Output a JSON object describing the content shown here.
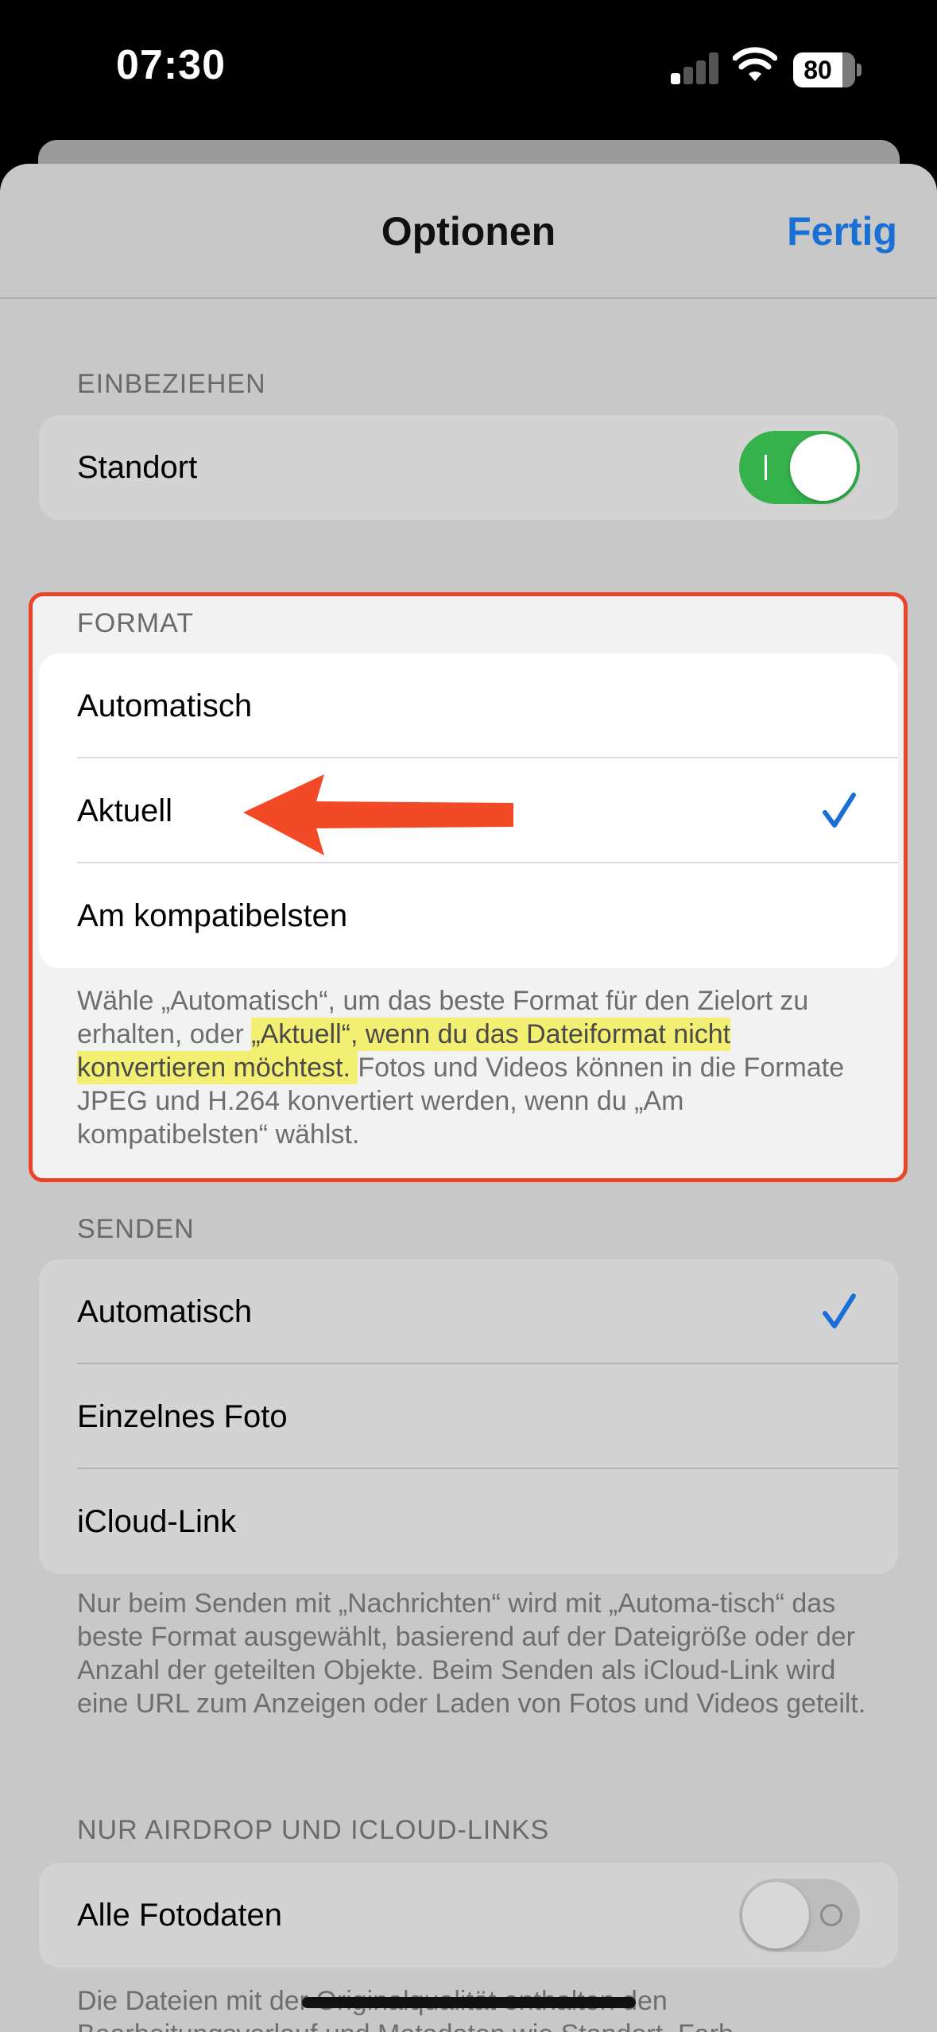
{
  "status_bar": {
    "time": "07:30",
    "battery_level": "80",
    "signal_bars_active": 1,
    "signal_bars_total": 4
  },
  "nav": {
    "title": "Optionen",
    "done_label": "Fertig"
  },
  "include": {
    "header": "EINBEZIEHEN",
    "location_label": "Standort",
    "location_on": true
  },
  "format": {
    "header": "FORMAT",
    "options": [
      "Automatisch",
      "Aktuell",
      "Am kompatibelsten"
    ],
    "selected": "Aktuell",
    "footnote_part1": "Wähle „Automatisch“, um das beste Format für den Zielort zu erhalten, oder ",
    "footnote_highlight": "„Aktuell“, wenn du das Dateiformat nicht konvertieren möchtest. ",
    "footnote_part2": "Fotos und Videos können in die Formate JPEG und H.264 konvertiert werden, wenn du „Am kompatibelsten“ wählst."
  },
  "send": {
    "header": "SENDEN",
    "options": [
      "Automatisch",
      "Einzelnes Foto",
      "iCloud-Link"
    ],
    "selected": "Automatisch",
    "footnote": "Nur beim Senden mit „Nachrichten“ wird mit „Automa-tisch“ das beste Format ausgewählt, basierend auf der Dateigröße oder der Anzahl der geteilten Objekte. Beim Senden als iCloud-Link wird eine URL zum Anzeigen oder Laden von Fotos und Videos geteilt."
  },
  "airdrop": {
    "header": "NUR AIRDROP UND ICLOUD-LINKS",
    "all_data_label": "Alle Fotodaten",
    "all_data_on": false,
    "footnote": "Die Dateien mit der Originalqualität enthalten den Bearbeitungsverlauf und Metadaten wie Standort, Farb"
  },
  "colors": {
    "accent": "#1a6fd6",
    "toggle_on": "#35b24c",
    "annotation_red": "#e8452a",
    "highlight_yellow": "#f2ef72"
  },
  "annotations": {
    "arrow_icon": "red-left-arrow",
    "box": "red-highlight-box"
  }
}
